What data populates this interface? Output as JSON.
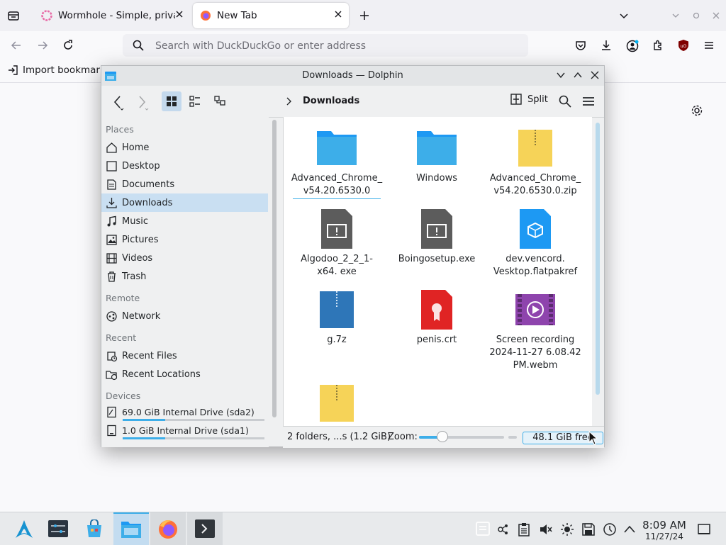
{
  "browser": {
    "tabs": [
      {
        "label": "Wormhole - Simple, privat",
        "icon": "wormhole-icon",
        "active": false
      },
      {
        "label": "New Tab",
        "icon": "firefox-icon",
        "active": true
      }
    ],
    "address_placeholder": "Search with DuckDuckGo or enter address",
    "bookmarks": {
      "import_label": "Import bookmark"
    }
  },
  "dolphin": {
    "title": "Downloads — Dolphin",
    "breadcrumb": "Downloads",
    "split_label": "Split",
    "places": {
      "sections": {
        "places": "Places",
        "remote": "Remote",
        "recent": "Recent",
        "devices": "Devices"
      },
      "items": [
        {
          "label": "Home",
          "icon": "home-icon"
        },
        {
          "label": "Desktop",
          "icon": "desktop-icon"
        },
        {
          "label": "Documents",
          "icon": "documents-icon"
        },
        {
          "label": "Downloads",
          "icon": "downloads-icon",
          "selected": true
        },
        {
          "label": "Music",
          "icon": "music-icon"
        },
        {
          "label": "Pictures",
          "icon": "pictures-icon"
        },
        {
          "label": "Videos",
          "icon": "videos-icon"
        },
        {
          "label": "Trash",
          "icon": "trash-icon"
        }
      ],
      "remote": [
        {
          "label": "Network",
          "icon": "network-icon"
        }
      ],
      "recent": [
        {
          "label": "Recent Files",
          "icon": "recent-files-icon"
        },
        {
          "label": "Recent Locations",
          "icon": "recent-locations-icon"
        }
      ],
      "devices": [
        {
          "label": "69.0 GiB Internal Drive (sda2)",
          "icon": "drive-icon",
          "usage": 0.3
        },
        {
          "label": "1.0 GiB Internal Drive (sda1)",
          "icon": "drive-icon",
          "usage": 0.3
        }
      ]
    },
    "files": [
      {
        "name": "Advanced_Chrome_ v54.20.6530.0",
        "type": "folder"
      },
      {
        "name": "Windows",
        "type": "folder"
      },
      {
        "name": "Advanced_Chrome_ v54.20.6530.0.zip",
        "type": "zip"
      },
      {
        "name": "Algodoo_2_2_1-x64. exe",
        "type": "exe"
      },
      {
        "name": "Boingosetup.exe",
        "type": "exe"
      },
      {
        "name": "dev.vencord. Vesktop.flatpakref",
        "type": "flatpak"
      },
      {
        "name": "g.7z",
        "type": "archive"
      },
      {
        "name": "penis.crt",
        "type": "certificate"
      },
      {
        "name": "Screen recording 2024-11-27 6.08.42 PM.webm",
        "type": "video"
      },
      {
        "name": "",
        "type": "zip"
      }
    ],
    "status": {
      "summary": "2 folders, ...s (1.2 GiB)",
      "zoom_label": "Zoom:",
      "zoom_level": 0.25,
      "free_space": "48.1 GiB free"
    }
  },
  "taskbar": {
    "clock_time": "8:09 AM",
    "clock_date": "11/27/24"
  },
  "colors": {
    "accent": "#3daee9",
    "folder": "#3daee9",
    "zip": "#f6d358",
    "exe": "#5c5c5c",
    "cert": "#e02424",
    "video": "#8e44ad"
  }
}
